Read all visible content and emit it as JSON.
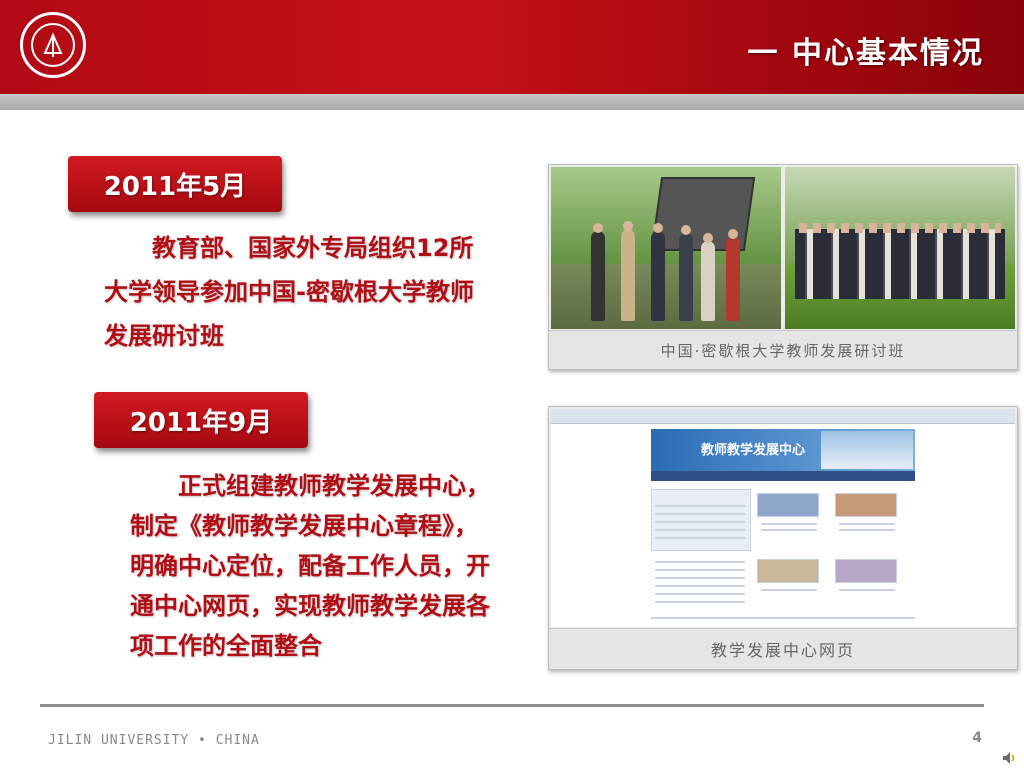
{
  "header": {
    "title": "一 中心基本情况"
  },
  "sections": [
    {
      "date": "2011年5月",
      "lines": [
        "　　教育部、国家外专局组织12所",
        "大学领导参加中国-密歇根大学教师",
        "发展研讨班"
      ]
    },
    {
      "date": "2011年9月",
      "lines": [
        "　　正式组建教师教学发展中心，",
        "制定《教师教学发展中心章程》，",
        "明确中心定位，配备工作人员，开",
        "通中心网页，实现教师教学发展各",
        "项工作的全面整合"
      ]
    }
  ],
  "photos": {
    "caption": "中国·密歇根大学教师发展研讨班"
  },
  "website": {
    "caption": "教学发展中心网页",
    "banner_title": "教师教学发展中心"
  },
  "footer": {
    "text": "JILIN  UNIVERSITY •  CHINA",
    "page": "4"
  },
  "colors": {
    "brand_red": "#c41018",
    "text_red": "#b10d14"
  },
  "icons": {
    "logo": "jilin-university-seal-icon",
    "speaker": "speaker-icon"
  }
}
